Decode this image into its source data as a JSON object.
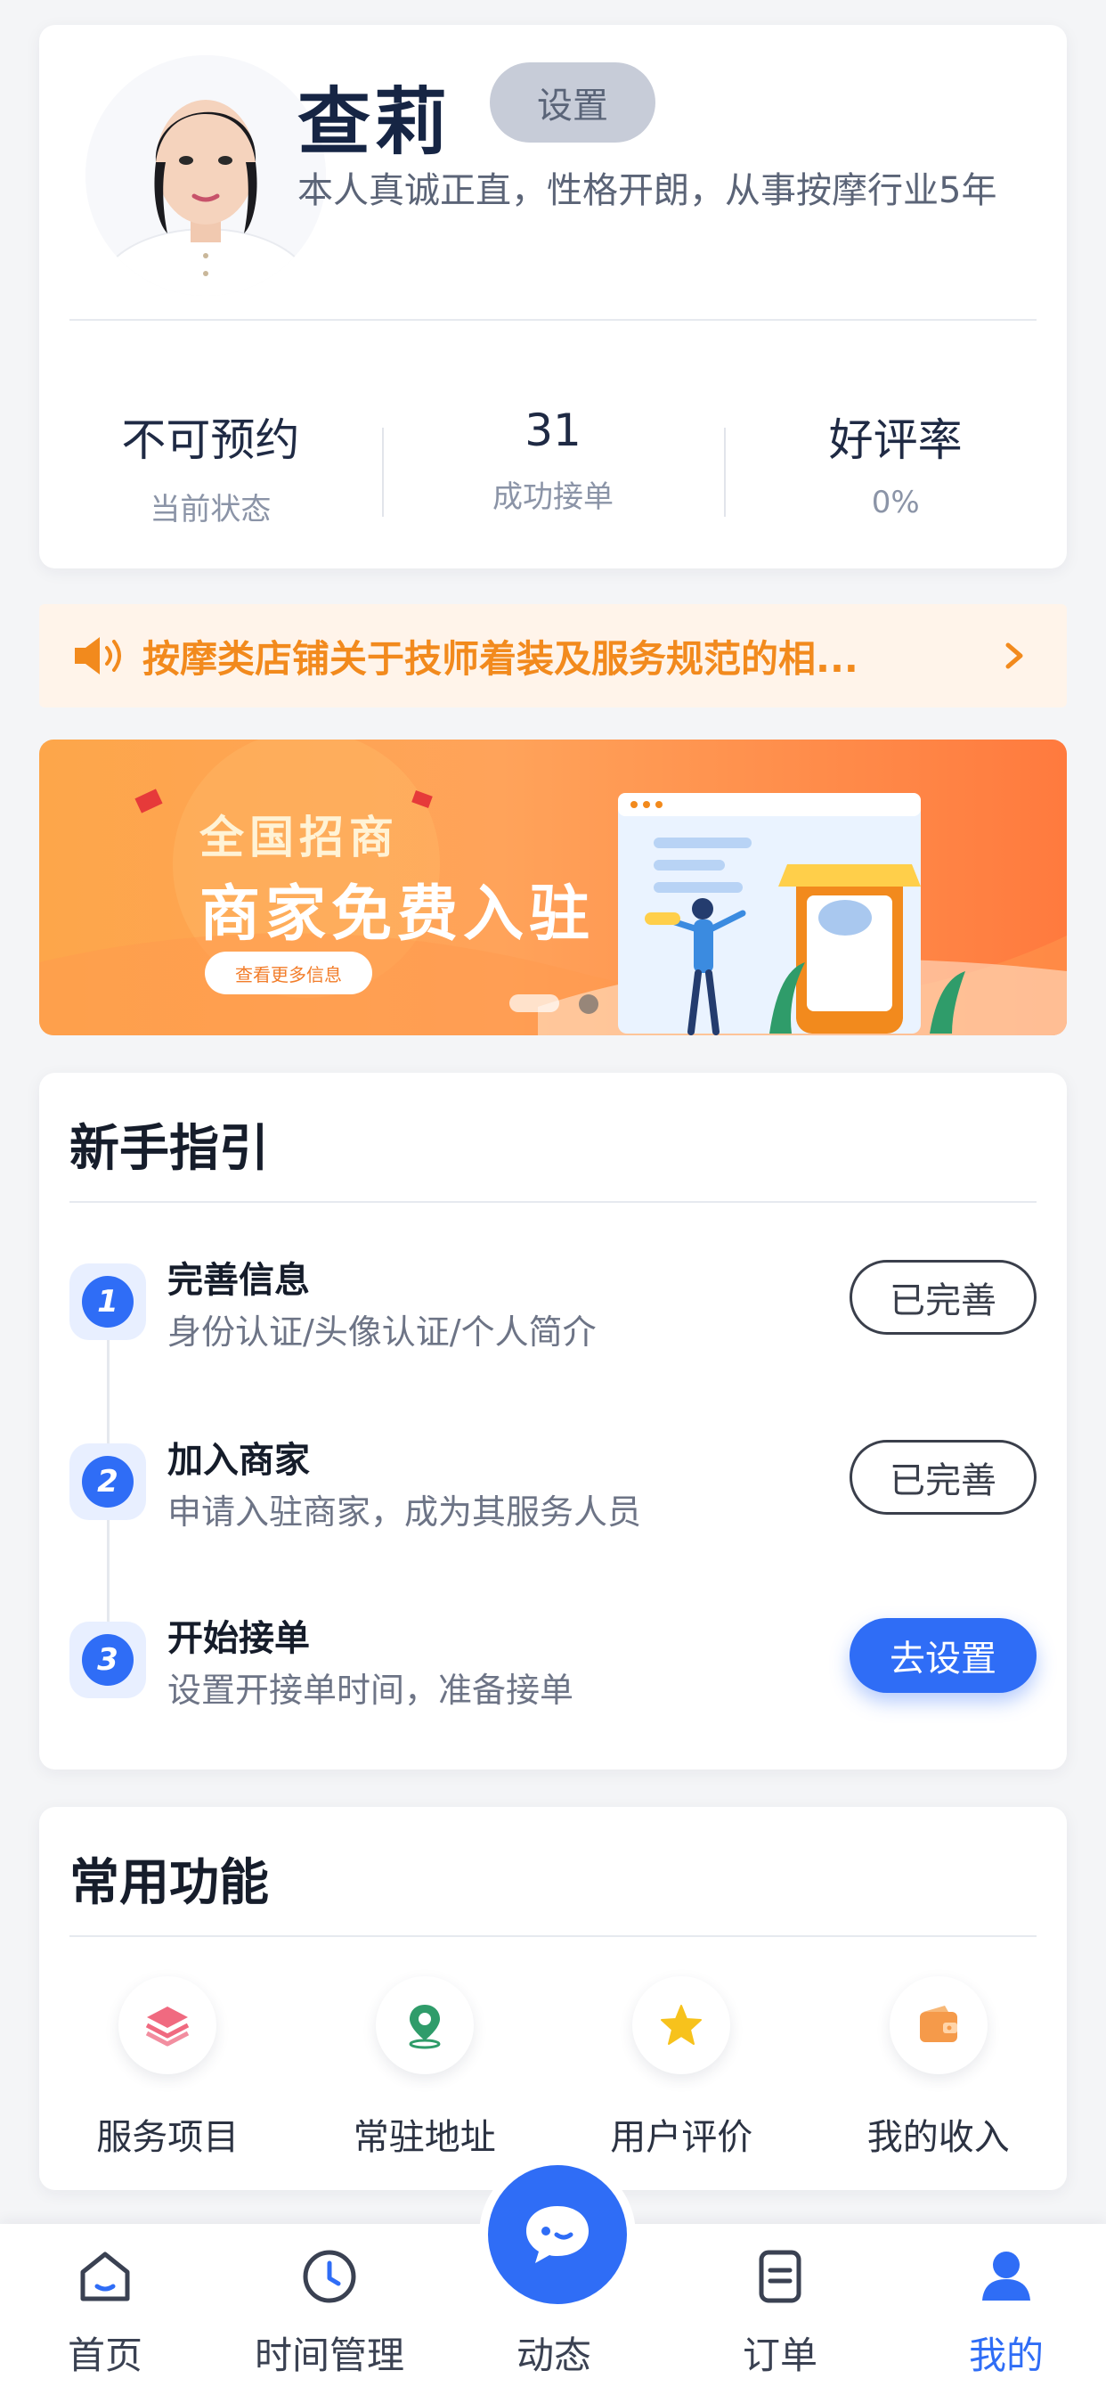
{
  "profile": {
    "name": "查莉",
    "settings_label": "设置",
    "bio": "本人真诚正直，性格开朗，从事按摩行业5年",
    "stats": [
      {
        "value": "不可预约",
        "label": "当前状态"
      },
      {
        "value": "31",
        "label": "成功接单"
      },
      {
        "value": "好评率",
        "label": "0%"
      }
    ]
  },
  "notice": {
    "text": "按摩类店铺关于技师着装及服务规范的相..."
  },
  "banner": {
    "line1": "全国招商",
    "line2": "商家免费入驻",
    "link": "查看更多信息"
  },
  "guide": {
    "title": "新手指引",
    "steps": [
      {
        "num": "1",
        "title": "完善信息",
        "desc": "身份认证/头像认证/个人简介",
        "button": "已完善"
      },
      {
        "num": "2",
        "title": "加入商家",
        "desc": "申请入驻商家，成为其服务人员",
        "button": "已完善"
      },
      {
        "num": "3",
        "title": "开始接单",
        "desc": "设置开接单时间，准备接单",
        "button": "去设置"
      }
    ]
  },
  "functions": {
    "title": "常用功能",
    "items": [
      {
        "label": "服务项目",
        "icon": "layers-icon"
      },
      {
        "label": "常驻地址",
        "icon": "location-pin-icon"
      },
      {
        "label": "用户评价",
        "icon": "star-icon"
      },
      {
        "label": "我的收入",
        "icon": "wallet-icon"
      }
    ]
  },
  "tabbar": {
    "items": [
      {
        "label": "首页",
        "icon": "home-icon"
      },
      {
        "label": "时间管理",
        "icon": "clock-icon"
      },
      {
        "label": "动态",
        "icon": "chat-bubble-icon"
      },
      {
        "label": "订单",
        "icon": "order-list-icon"
      },
      {
        "label": "我的",
        "icon": "user-icon",
        "active": true
      }
    ]
  },
  "colors": {
    "accent": "#2f6df6",
    "notice_text": "#f28a1d",
    "notice_bg": "#fff4ea",
    "banner_start": "#fda64a",
    "banner_end": "#ff7a3e"
  }
}
